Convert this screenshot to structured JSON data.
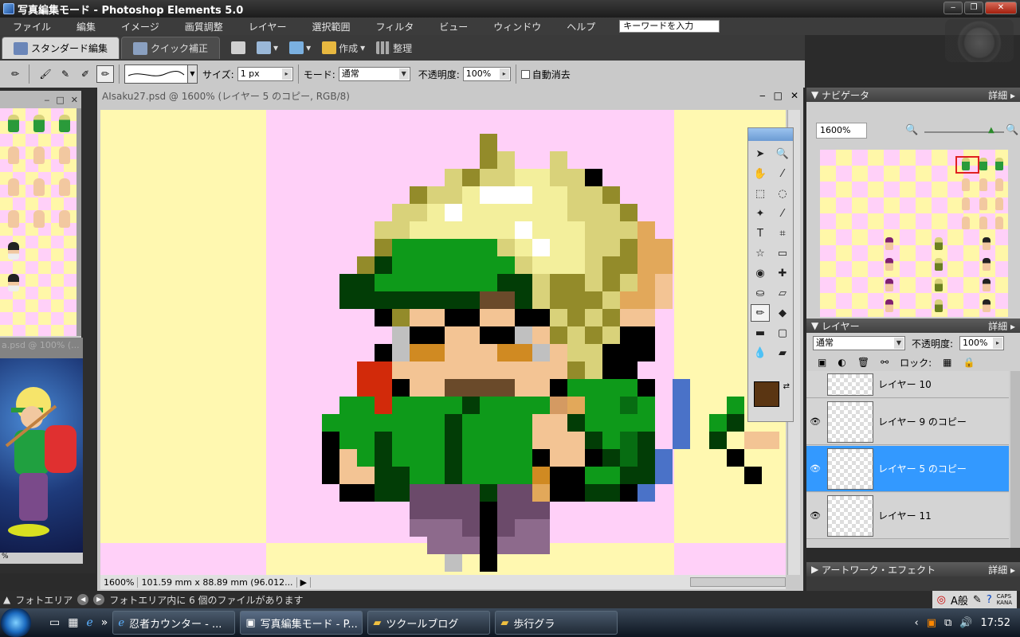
{
  "window": {
    "title": "写真編集モード - Photoshop Elements 5.0"
  },
  "menu": {
    "items": [
      "ファイル",
      "編集",
      "イメージ",
      "画質調整",
      "レイヤー",
      "選択範囲",
      "フィルタ",
      "ビュー",
      "ウィンドウ",
      "ヘルプ"
    ],
    "search_placeholder": "キーワードを入力"
  },
  "modetabs": {
    "standard": "スタンダード編集",
    "quick": "クイック補正"
  },
  "toolbar": {
    "create": "作成",
    "organize": "整理"
  },
  "options": {
    "size_label": "サイズ:",
    "size_value": "1 px",
    "mode_label": "モード:",
    "mode_value": "通常",
    "opacity_label": "不透明度:",
    "opacity_value": "100%",
    "autoerase_label": "自動消去"
  },
  "leftpanel": {
    "win2_title": "a.psd @ 100% (...",
    "art_status": "%"
  },
  "document": {
    "title": "AIsaku27.psd @ 1600% (レイヤー 5 のコピー, RGB/8)",
    "zoom": "1600%",
    "size": "101.59 mm x 88.89 mm (96.012..."
  },
  "navigator": {
    "title": "ナビゲータ",
    "more": "詳細",
    "zoom": "1600%"
  },
  "layers": {
    "title": "レイヤー",
    "more": "詳細",
    "blend_mode": "通常",
    "opacity_label": "不透明度:",
    "opacity_value": "100%",
    "lock_label": "ロック:",
    "rows": [
      {
        "name": "レイヤー 10",
        "visible": false
      },
      {
        "name": "レイヤー 9 のコピー",
        "visible": true
      },
      {
        "name": "レイヤー 5 のコピー",
        "visible": true,
        "selected": true
      },
      {
        "name": "レイヤー 11",
        "visible": true
      }
    ]
  },
  "effects": {
    "title": "アートワーク・エフェクト",
    "more": "詳細"
  },
  "photobin": {
    "label": "フォトエリア",
    "message": "フォトエリア内に 6 個のファイルがあります"
  },
  "taskbar": {
    "tasks": [
      "忍者カウンター - ...",
      "写真編集モード - P...",
      "ツクールブログ",
      "歩行グラ"
    ],
    "clock": "17:52",
    "caps": "CAPS",
    "kana": "KANA"
  },
  "colors": {
    "foreground": "#5a3512",
    "accent": "#3399ff"
  }
}
